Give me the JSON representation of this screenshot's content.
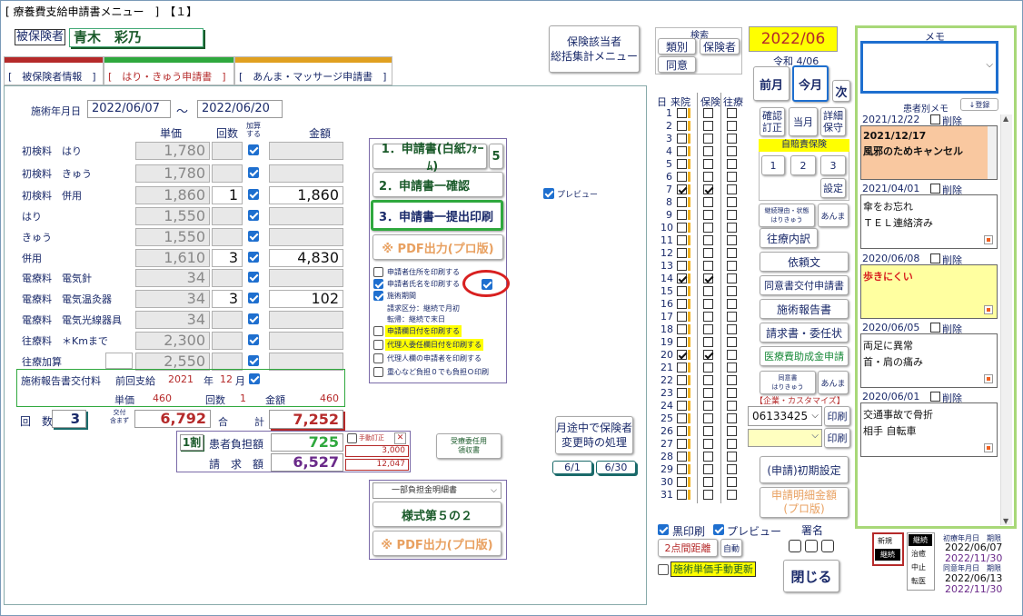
{
  "window": {
    "title": "[ 療養費支給申請書メニュー　]　【１】"
  },
  "patient": {
    "label": "被保険者",
    "name": "青木　彩乃"
  },
  "tabs": [
    "[　被保険者情報　]",
    "[　はり・きゅう申請書　]",
    "[　あんま・マッサージ申請書　]"
  ],
  "period": {
    "label": "施術年月日",
    "start": "2022/06/07",
    "tilde": "～",
    "end": "2022/06/20"
  },
  "cols": {
    "unit": "単価",
    "count": "回数",
    "add1": "加算",
    "add2": "する",
    "amount": "金額"
  },
  "fees": [
    {
      "label": "初検料　はり",
      "price": "1,780",
      "count": "",
      "checked": true,
      "amount": ""
    },
    {
      "label": "初検料　きゅう",
      "price": "1,780",
      "count": "",
      "checked": true,
      "amount": ""
    },
    {
      "label": "初検料　併用",
      "price": "1,860",
      "count": "1",
      "checked": true,
      "amount": "1,860"
    },
    {
      "label": "はり",
      "price": "1,550",
      "count": "",
      "checked": true,
      "amount": ""
    },
    {
      "label": "きゅう",
      "price": "1,550",
      "count": "",
      "checked": true,
      "amount": ""
    },
    {
      "label": "併用",
      "price": "1,610",
      "count": "3",
      "checked": true,
      "amount": "4,830"
    },
    {
      "label": "電療料　電気針",
      "price": "34",
      "count": "",
      "checked": true,
      "amount": ""
    },
    {
      "label": "電療料　電気温灸器",
      "price": "34",
      "count": "3",
      "checked": true,
      "amount": "102"
    },
    {
      "label": "電療料　電気光線器具",
      "price": "34",
      "count": "",
      "checked": true,
      "amount": ""
    },
    {
      "label": "往療料　＊Kmまで",
      "price": "2,300",
      "count": "",
      "checked": true,
      "amount": ""
    },
    {
      "label": "往療加算",
      "price": "2,550",
      "count": "",
      "checked": true,
      "amount": ""
    }
  ],
  "report": {
    "label": "施術報告書交付料",
    "prev": "前回支給",
    "year": "2021",
    "nen": "年",
    "month": "12",
    "gatsu": "月",
    "unit_label": "単価",
    "unit": "460",
    "count_label": "回数",
    "count": "1",
    "amount_label": "金額",
    "amount": "460"
  },
  "totals": {
    "count_label": "回　数",
    "count": "3",
    "kofu1": "交付",
    "kofu2": "含まず",
    "subtotal": "6,792",
    "gokei1": "合",
    "gokei2": "計",
    "total": "7,252"
  },
  "burden": {
    "ratio": "1割",
    "patient_label": "患者負担額",
    "patient": "725",
    "claim_label": "請　求　額",
    "claim": "6,527",
    "manual": "手動訂正",
    "x": "✕",
    "v1": "3,000",
    "v2": "12,047"
  },
  "delegate": {
    "line1": "受療委任用",
    "line2": "領収書"
  },
  "print_panel": {
    "b1": "1．申請書(白紙ﾌｫｰﾑ)",
    "b1n": "5",
    "b2": "2．申請書一確認",
    "b3": "3．申請書一提出印刷",
    "pdf": "※ PDF出力(プロ版)",
    "opts": [
      {
        "text": "申請者住所を印刷する",
        "checked": false,
        "hl": false
      },
      {
        "text": "申請者氏名を印刷する",
        "checked": true,
        "hl": false
      },
      {
        "text": "施術期間",
        "checked": true,
        "hl": false
      }
    ],
    "info1": "請求区分：継続で月初",
    "info2": "転帰：継続で末日",
    "opts2": [
      {
        "text": "申請欄日付を印刷する",
        "checked": false,
        "hl": true
      },
      {
        "text": "代理人委任欄日付を印刷する",
        "checked": false,
        "hl": true
      },
      {
        "text": "代理人欄の申請者を印刷する",
        "checked": false,
        "hl": false
      },
      {
        "text": "重心など負担０でも負担Ｏ印刷",
        "checked": false,
        "hl": false
      }
    ]
  },
  "preview": {
    "label": "プレビュー"
  },
  "form5": {
    "select": "一部負担金明細書",
    "title": "様式第５の２",
    "pdf": "※ PDF出力(プロ版)"
  },
  "midway": {
    "l1": "月途中で保険者",
    "l2": "変更時の処理",
    "d1": "6/1",
    "d2": "6/30"
  },
  "summary_btn": {
    "l1": "保険該当者",
    "l2": "総括集計メニュー"
  },
  "search": {
    "title": "検索",
    "b1": "類別",
    "b2": "保険者",
    "b3": "同意"
  },
  "month": {
    "ym": "2022/06",
    "era": "令和 4/06",
    "prev": "前月",
    "now": "今月",
    "next": "次"
  },
  "calendar": {
    "h1": "日",
    "h2": "来院",
    "h3": "保険",
    "h4": "往療",
    "visits": [
      7,
      14,
      20
    ]
  },
  "actions": {
    "confirm": "確認訂正",
    "tougetsu": "当月",
    "detail": "詳細保守",
    "jibai": "自賠責保険",
    "n1": "1",
    "n2": "2",
    "n3": "3",
    "settei": "設定",
    "reason": "継続理由・状態",
    "reason2": "はりきゅう",
    "anma1": "あんま",
    "ouryo": "往療内訳",
    "irai": "依頼文",
    "doui": "同意書交付申請書",
    "houkoku": "施術報告書",
    "seikyu": "請求書・委任状",
    "iryo": "医療費助成金申請",
    "doui2": "同意書",
    "doui2b": "はりきゅう",
    "anma2": "あんま",
    "custom": "【企業・カスタマイズ】",
    "code": "06133425",
    "print1": "印刷",
    "print2": "印刷",
    "init": "(申請)初期設定",
    "meisai1": "申請明細金額",
    "meisai2": "(プロ版)"
  },
  "bottom": {
    "kuro": "黒印刷",
    "preview": "プレビュー",
    "shomei": "署名",
    "kyori": "2点間距離",
    "jido": "自動",
    "manual_update": "施術単価手動更新",
    "close": "閉じる"
  },
  "status": {
    "shinki": "新規",
    "keizoku": "継続",
    "keizoku2": "継続",
    "chiyu": "治癒",
    "chushi": "中止",
    "teni": "転医",
    "first_label": "初療年月日",
    "kigen": "期限",
    "first": "2022/06/07",
    "first_end": "2022/11/30",
    "doui_label": "同意年月日",
    "doui": "2022/06/13",
    "doui_end": "2022/11/30"
  },
  "memo": {
    "title": "メモ",
    "patient_memo": "患者別メモ",
    "register": "↓登録",
    "delete": "削除",
    "items": [
      {
        "date": "2021/12/22",
        "text1": "2021/12/17",
        "text2": "風邪のためキャンセル",
        "bg": "#f9c8a0"
      },
      {
        "date": "2021/04/01",
        "text1": "傘をお忘れ",
        "text2": "ＴＥＬ連絡済み",
        "bg": "#ffffff"
      },
      {
        "date": "2020/06/08",
        "text1": "歩きにくい",
        "text2": "",
        "bg": "#ffffa0"
      },
      {
        "date": "2020/06/05",
        "text1": "両足に異常",
        "text2": "首・肩の痛み",
        "bg": "#ffffff"
      },
      {
        "date": "2020/06/01",
        "text1": "交通事故で骨折",
        "text2": "相手 自転車",
        "bg": "#ffffff"
      }
    ]
  }
}
